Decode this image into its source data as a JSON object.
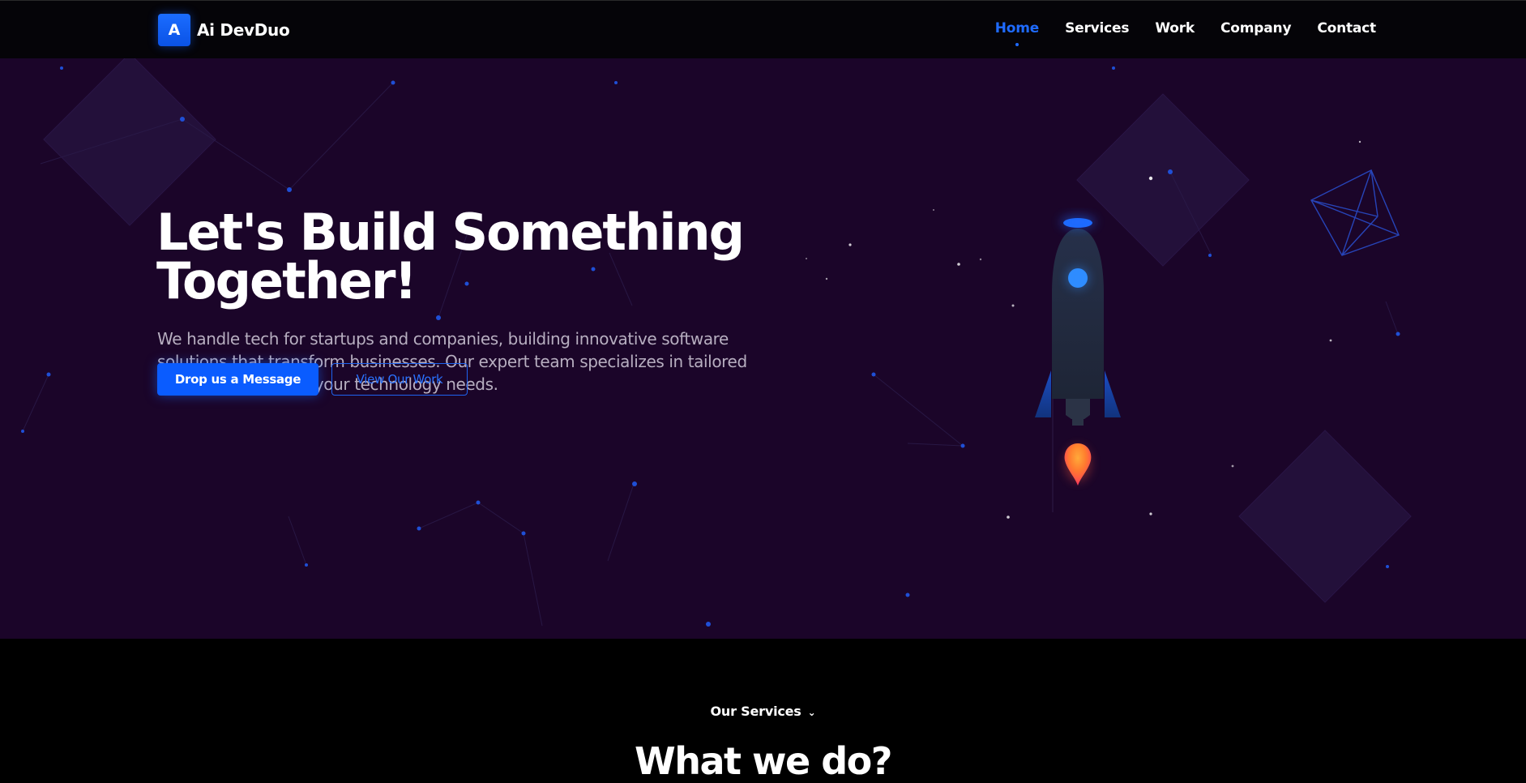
{
  "brand": {
    "mark": "A",
    "name": "Ai DevDuo"
  },
  "nav": {
    "items": [
      {
        "label": "Home",
        "active": true
      },
      {
        "label": "Services",
        "active": false
      },
      {
        "label": "Work",
        "active": false
      },
      {
        "label": "Company",
        "active": false
      },
      {
        "label": "Contact",
        "active": false
      }
    ]
  },
  "hero": {
    "title_line1": "Let's Build Something",
    "title_line2": "Together!",
    "subtitle": "We handle tech for startups and companies, building innovative software solutions that transform businesses. Our expert team specializes in tailored development for all your technology needs.",
    "primary_cta": "Drop us a Message",
    "secondary_cta": "View Our Work"
  },
  "services": {
    "tag": "Our Services",
    "title": "What we do?"
  },
  "colors": {
    "accent": "#0a5cff",
    "hero_bg": "#1b0529",
    "header_bg": "#050408",
    "page_bg": "#000000",
    "subtitle_text": "#b7aec0"
  },
  "icons": [
    "logo-mark",
    "chevron-down-icon",
    "rocket-illustration",
    "wireframe-cube-icon"
  ]
}
